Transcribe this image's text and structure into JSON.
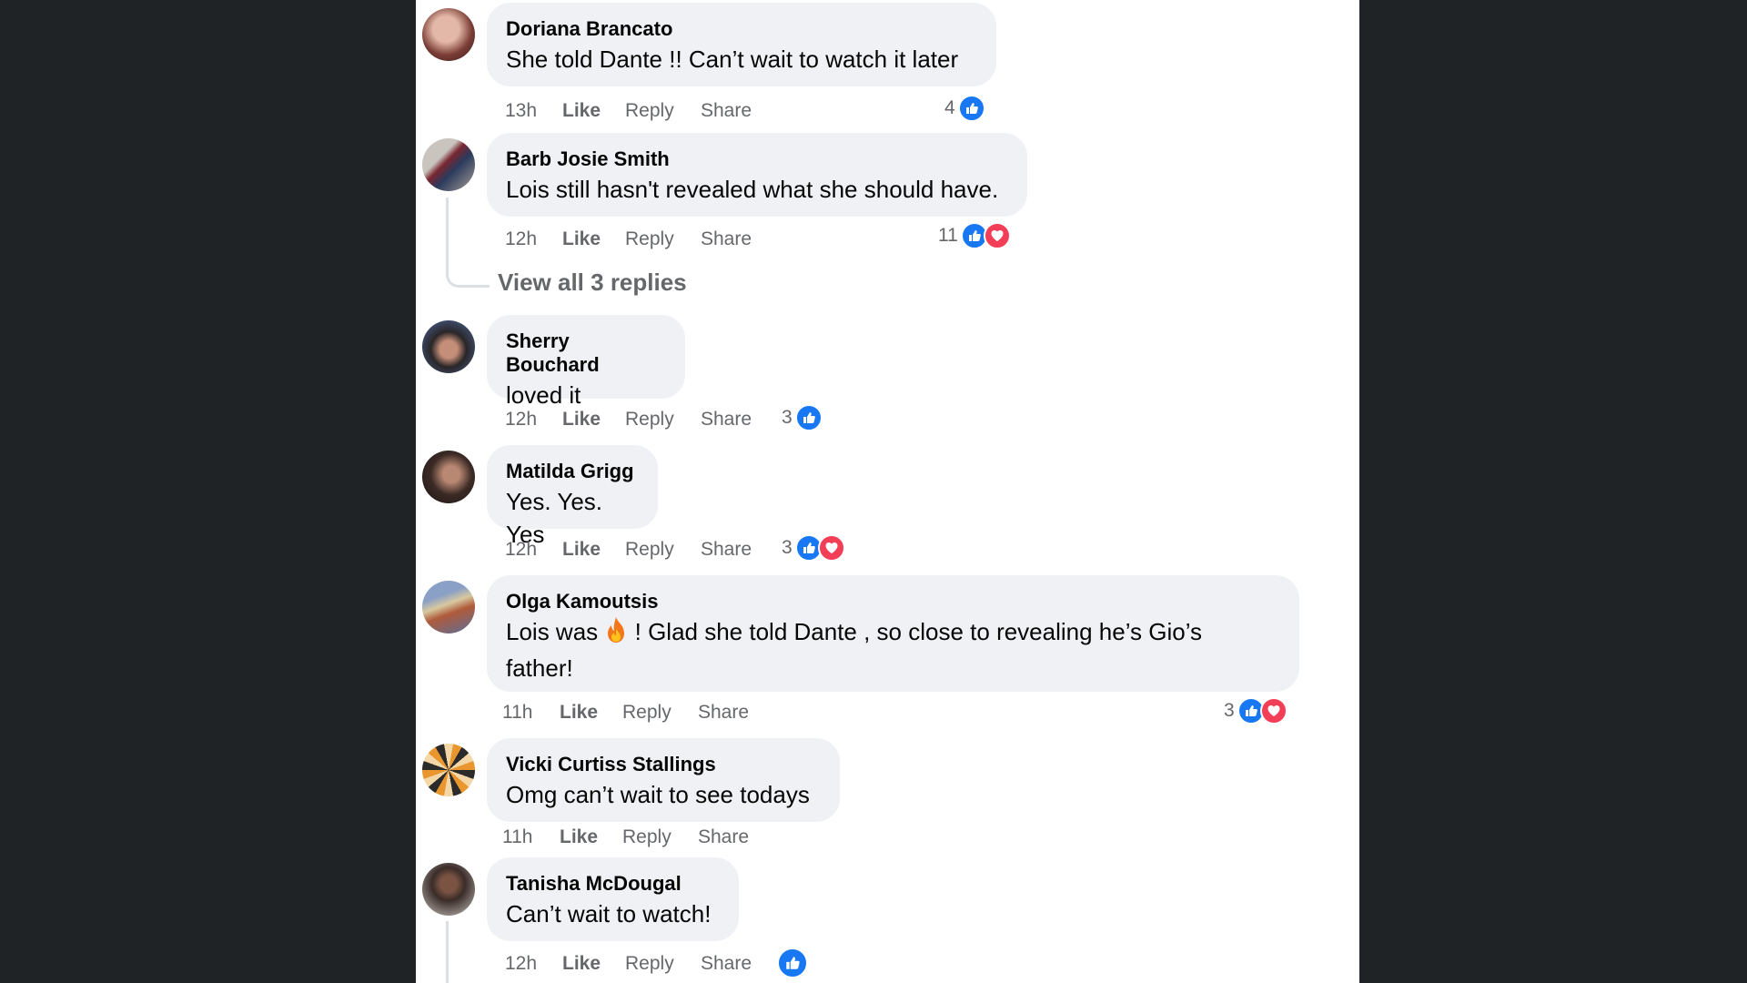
{
  "comments": [
    {
      "name": "Doriana Brancato",
      "text": "She told Dante !! Can’t wait to watch it later",
      "time": "13h",
      "like": "Like",
      "reply": "Reply",
      "share": "Share",
      "reaction_count": "4",
      "reactions": [
        "like-icon"
      ]
    },
    {
      "name": "Barb Josie Smith",
      "text": "Lois still hasn't revealed what she should have.",
      "time": "12h",
      "like": "Like",
      "reply": "Reply",
      "share": "Share",
      "reaction_count": "11",
      "reactions": [
        "like-icon",
        "love-icon"
      ]
    },
    {
      "name": "Sherry Bouchard",
      "text": "loved it",
      "time": "12h",
      "like": "Like",
      "reply": "Reply",
      "share": "Share",
      "reaction_count": "3",
      "reactions": [
        "like-icon"
      ]
    },
    {
      "name": "Matilda Grigg",
      "text": "Yes. Yes. Yes",
      "time": "12h",
      "like": "Like",
      "reply": "Reply",
      "share": "Share",
      "reaction_count": "3",
      "reactions": [
        "like-icon",
        "love-icon"
      ]
    },
    {
      "name": "Olga Kamoutsis",
      "text_before": "Lois was",
      "text_after": "! Glad she told Dante , so close to revealing he’s Gio’s",
      "text_line2": "father!",
      "time": "11h",
      "like": "Like",
      "reply": "Reply",
      "share": "Share",
      "reaction_count": "3",
      "reactions": [
        "like-icon",
        "love-icon"
      ]
    },
    {
      "name": "Vicki Curtiss Stallings",
      "text": "Omg can’t wait to see todays",
      "time": "11h",
      "like": "Like",
      "reply": "Reply",
      "share": "Share"
    },
    {
      "name": "Tanisha McDougal",
      "text": "Can’t wait to watch!",
      "time": "12h",
      "like": "Like",
      "reply": "Reply",
      "share": "Share",
      "reactions": [
        "like-icon"
      ]
    }
  ],
  "view_replies": "View all 3 replies",
  "colors": {
    "like": "#1877f2",
    "love": "#f33e58",
    "bubble": "#eff1f4",
    "meta": "#65676b"
  }
}
